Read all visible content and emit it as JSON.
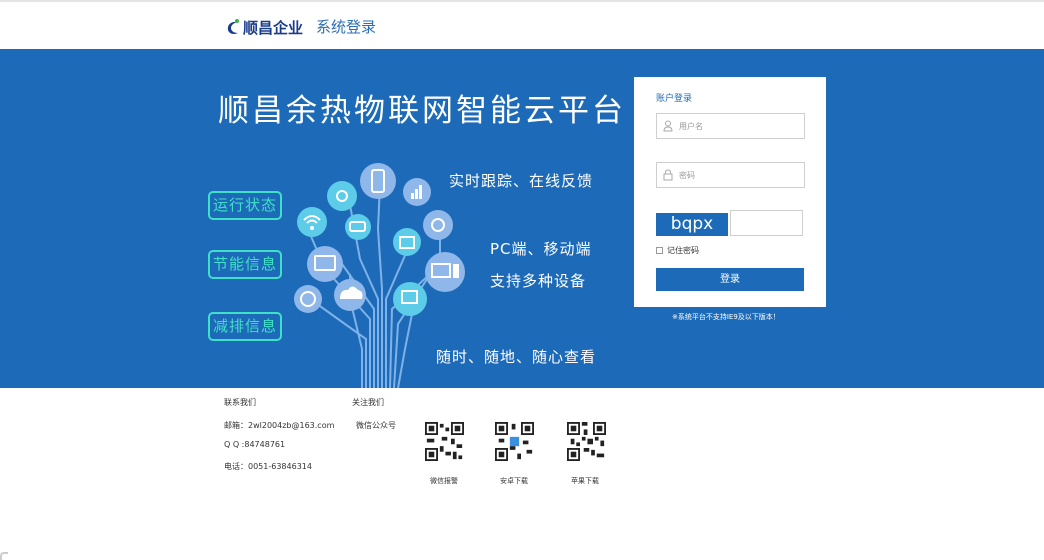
{
  "header": {
    "logo_text": "顺昌企业",
    "subtitle": "系统登录"
  },
  "banner": {
    "title": "顺昌余热物联网智能云平台",
    "features": [
      "运行状态",
      "节能信息",
      "减排信息"
    ],
    "slogans": [
      "实时跟踪、在线反馈",
      "PC端、移动端",
      "支持多种设备",
      "随时、随地、随心查看"
    ]
  },
  "login": {
    "title": "账户登录",
    "username_placeholder": "用户名",
    "password_placeholder": "密码",
    "captcha_text": "bqpx",
    "captcha_value": "",
    "remember_label": "记住密码",
    "submit_label": "登录",
    "notice": "※系统平台不支持IE9及以下版本！"
  },
  "footer": {
    "contact_heading": "联系我们",
    "follow_heading": "关注我们",
    "email": "邮箱：2wl2004zb@163.com",
    "qq": "Q Q :84748761",
    "phone": "电话：0051-63846314",
    "wechat_account": "微信公众号",
    "qr_labels": [
      "微信报警",
      "安卓下载",
      "苹果下载"
    ]
  },
  "colors": {
    "brand_blue": "#1d6bb8",
    "accent_teal": "#3fe0c8",
    "logo_navy": "#1a3c8c"
  },
  "icons": {
    "logo": "company-logo-icon",
    "user": "user-icon",
    "lock": "lock-icon"
  }
}
